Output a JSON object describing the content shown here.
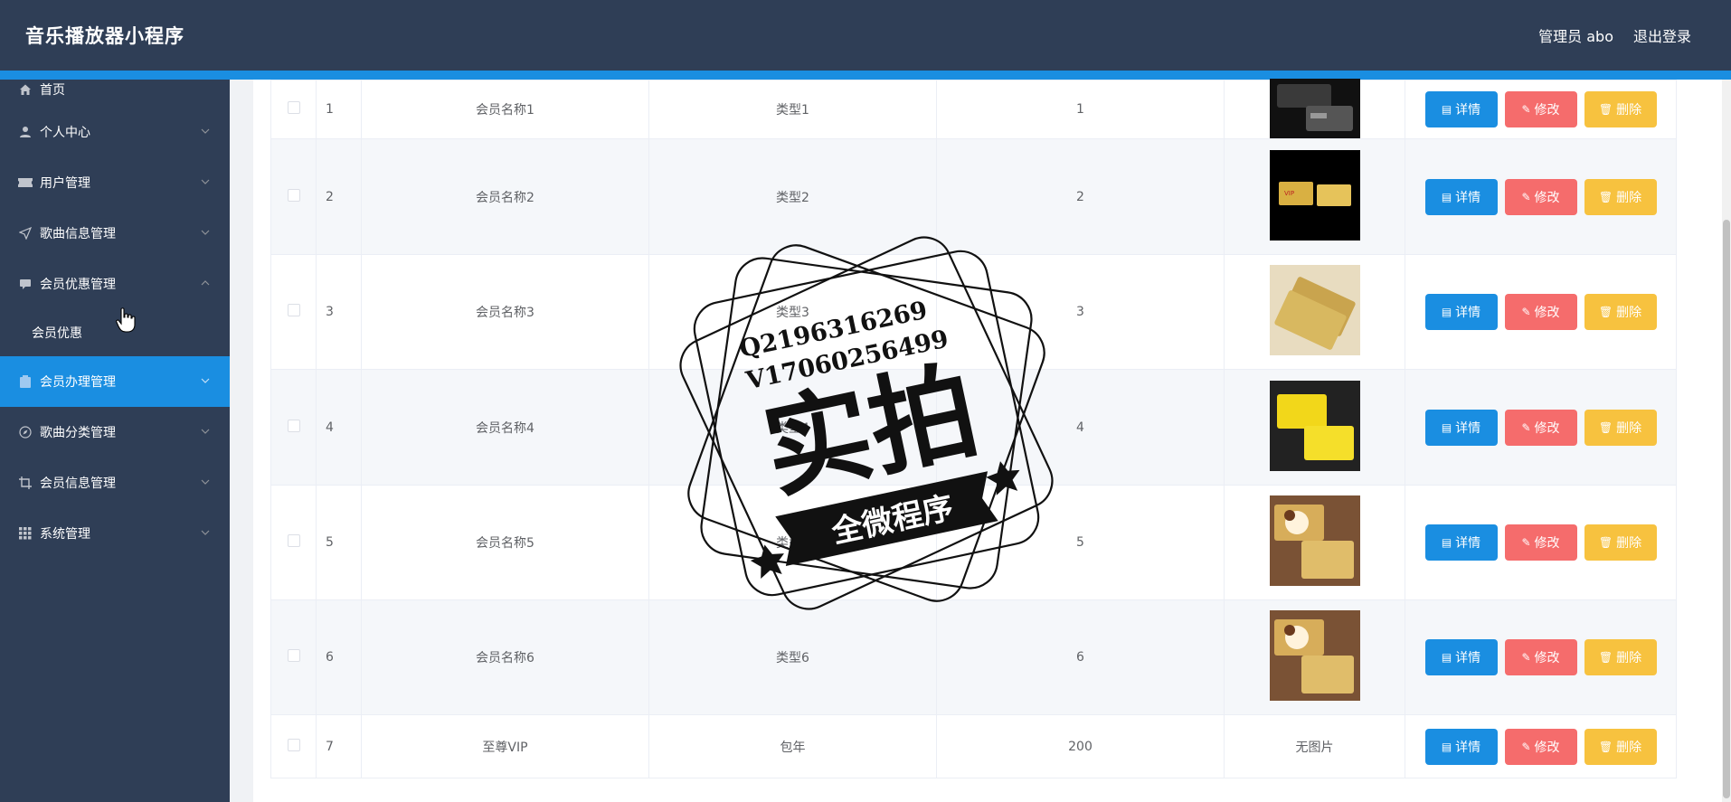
{
  "header": {
    "app_title": "音乐播放器小程序",
    "admin_label": "管理员 abo",
    "logout_label": "退出登录"
  },
  "sidebar": {
    "items": [
      {
        "label": "首页",
        "icon": "home-icon",
        "chevron": false
      },
      {
        "label": "个人中心",
        "icon": "user-icon",
        "chevron": true
      },
      {
        "label": "用户管理",
        "icon": "ticket-icon",
        "chevron": true
      },
      {
        "label": "歌曲信息管理",
        "icon": "send-icon",
        "chevron": true
      },
      {
        "label": "会员优惠管理",
        "icon": "chat-icon",
        "chevron": true,
        "expanded": true
      },
      {
        "label": "会员优惠",
        "sub": true
      },
      {
        "label": "会员办理管理",
        "icon": "clipboard-icon",
        "chevron": true,
        "active": true
      },
      {
        "label": "歌曲分类管理",
        "icon": "compass-icon",
        "chevron": true
      },
      {
        "label": "会员信息管理",
        "icon": "crop-icon",
        "chevron": true
      },
      {
        "label": "系统管理",
        "icon": "grid-icon",
        "chevron": true
      }
    ]
  },
  "table": {
    "rows": [
      {
        "index": "1",
        "name": "会员名称1",
        "type": "类型1",
        "value": "1",
        "image": "card-dark"
      },
      {
        "index": "2",
        "name": "会员名称2",
        "type": "类型2",
        "value": "2",
        "image": "card-gold-black"
      },
      {
        "index": "3",
        "name": "会员名称3",
        "type": "类型3",
        "value": "3",
        "image": "card-gold"
      },
      {
        "index": "4",
        "name": "会员名称4",
        "type": "类型4",
        "value": "4",
        "image": "card-yellow"
      },
      {
        "index": "5",
        "name": "会员名称5",
        "type": "类型5",
        "value": "5",
        "image": "card-dog"
      },
      {
        "index": "6",
        "name": "会员名称6",
        "type": "类型6",
        "value": "6",
        "image": "card-dog"
      },
      {
        "index": "7",
        "name": "至尊VIP",
        "type": "包年",
        "value": "200",
        "image_text": "无图片"
      }
    ],
    "actions": {
      "detail": "详情",
      "edit": "修改",
      "delete": "删除"
    }
  },
  "watermark": {
    "line1": "Q2196316269",
    "line2": "V17060256499",
    "big": "实拍",
    "ribbon": "全微程序"
  },
  "colors": {
    "header_bg": "#2f3e56",
    "accent": "#1a8ee1",
    "edit": "#f56c6c",
    "delete": "#f7c23f"
  }
}
